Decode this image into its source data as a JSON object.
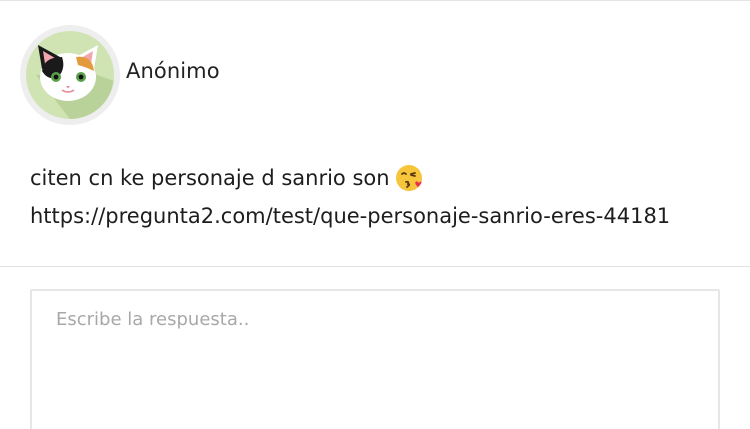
{
  "post": {
    "author": "Anónimo",
    "avatar_icon": "calico-cat-icon",
    "question_line1": "citen cn ke personaje d sanrio son",
    "question_emoji": "kissing-face-blowing-heart-emoji",
    "question_link": "https://pregunta2.com/test/que-personaje-sanrio-eres-44181"
  },
  "answer": {
    "placeholder": "Escribe la respuesta.."
  },
  "colors": {
    "avatar_bg": "#cfe3b3",
    "divider": "#e2e2e2",
    "border": "#e6e6e6"
  }
}
